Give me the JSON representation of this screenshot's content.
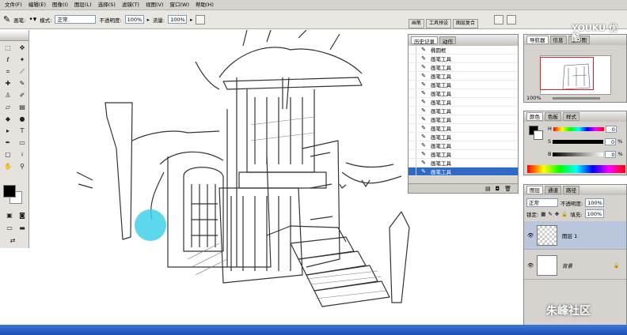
{
  "menu": [
    "文件(F)",
    "编辑(E)",
    "图像(I)",
    "图层(L)",
    "选择(S)",
    "滤镜(T)",
    "视图(V)",
    "窗口(W)",
    "帮助(H)"
  ],
  "options": {
    "brush_label": "画笔:",
    "mode_label": "模式:",
    "mode_value": "正常",
    "opacity_label": "不透明度:",
    "opacity_value": "100%",
    "flow_label": "流量:",
    "flow_value": "100%"
  },
  "well_tabs": [
    "画笔",
    "工具预设",
    "图层复合"
  ],
  "history": {
    "tabs": [
      "历史记录",
      "动作"
    ],
    "items": [
      "椭圆框",
      "画笔工具",
      "画笔工具",
      "画笔工具",
      "画笔工具",
      "画笔工具",
      "画笔工具",
      "画笔工具",
      "画笔工具",
      "画笔工具",
      "画笔工具",
      "画笔工具",
      "画笔工具",
      "画笔工具",
      "画笔工具"
    ]
  },
  "navigator": {
    "tabs": [
      "导航器",
      "信息",
      "直方图"
    ],
    "zoom": "100%"
  },
  "color": {
    "tabs": [
      "颜色",
      "色板",
      "样式"
    ],
    "channels": [
      {
        "name": "H",
        "value": "0"
      },
      {
        "name": "S",
        "value": "0",
        "unit": "%"
      },
      {
        "name": "B",
        "value": "0",
        "unit": "%"
      }
    ]
  },
  "layers": {
    "tabs": [
      "图层",
      "通道",
      "路径"
    ],
    "mode": "正常",
    "opacity_label": "不透明度:",
    "opacity": "100%",
    "lock_label": "锁定:",
    "fill_label": "填充:",
    "fill": "100%",
    "items": [
      {
        "name": "图层 1"
      },
      {
        "name": "背景"
      }
    ]
  },
  "watermark_top": "YOUKU 优酷",
  "watermark_bottom": "朱峰社区"
}
